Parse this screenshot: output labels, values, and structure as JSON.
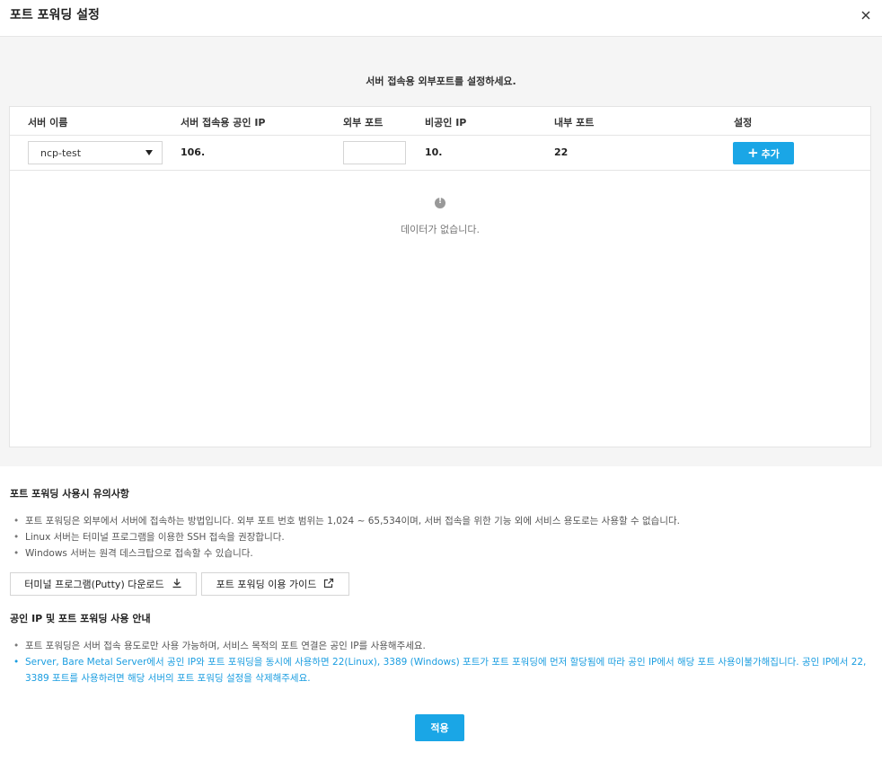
{
  "modal": {
    "title": "포트 포워딩 설정"
  },
  "instruction": "서버 접속용 외부포트를 설정하세요.",
  "table": {
    "headers": [
      "서버 이름",
      "서버 접속용 공인 IP",
      "외부 포트",
      "비공인 IP",
      "내부 포트",
      "설정"
    ],
    "row": {
      "server_name": "ncp-test",
      "public_ip": "106.",
      "external_port": "",
      "private_ip": "10.",
      "internal_port": "22",
      "add_label": "추가"
    },
    "empty_text": "데이터가 없습니다."
  },
  "notice": {
    "title": "포트 포워딩 사용시 유의사항",
    "items": [
      "포트 포워딩은 외부에서 서버에 접속하는 방법입니다. 외부 포트 번호 범위는 1,024 ~ 65,534이며, 서버 접속을 위한 기능 외에 서비스 용도로는 사용할 수 없습니다.",
      "Linux 서버는 터미널 프로그램을 이용한 SSH 접속을 권장합니다.",
      "Windows 서버는 원격 데스크탑으로 접속할 수 있습니다."
    ],
    "download_label": "터미널 프로그램(Putty) 다운로드",
    "guide_label": "포트 포워딩 이용 가이드"
  },
  "public_ip_guide": {
    "title": "공인 IP 및 포트 포워딩 사용 안내",
    "items": [
      "포트 포워딩은 서버 접속 용도로만 사용 가능하며, 서비스 목적의 포트 연결은 공인 IP를 사용해주세요.",
      "Server, Bare Metal Server에서 공인 IP와 포트 포워딩을 동시에 사용하면 22(Linux), 3389 (Windows) 포트가 포트 포워딩에 먼저 할당됨에 따라 공인 IP에서 해당 포트 사용이불가해집니다. 공인 IP에서 22, 3389 포트를 사용하려면 해당 서버의 포트 포워딩 설정을 삭제해주세요."
    ]
  },
  "apply_label": "적용",
  "colors": {
    "accent": "#1aa6e6",
    "highlight_text": "#1a9de0"
  }
}
